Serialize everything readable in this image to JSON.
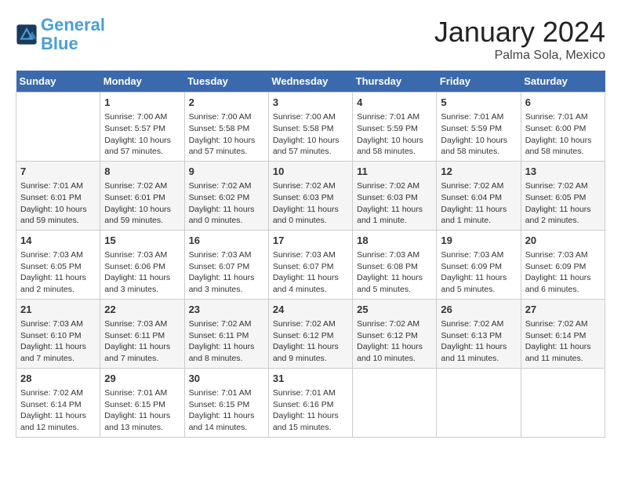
{
  "header": {
    "logo_line1": "General",
    "logo_line2": "Blue",
    "month_title": "January 2024",
    "location": "Palma Sola, Mexico"
  },
  "columns": [
    "Sunday",
    "Monday",
    "Tuesday",
    "Wednesday",
    "Thursday",
    "Friday",
    "Saturday"
  ],
  "weeks": [
    [
      {
        "day": "",
        "content": ""
      },
      {
        "day": "1",
        "content": "Sunrise: 7:00 AM\nSunset: 5:57 PM\nDaylight: 10 hours\nand 57 minutes."
      },
      {
        "day": "2",
        "content": "Sunrise: 7:00 AM\nSunset: 5:58 PM\nDaylight: 10 hours\nand 57 minutes."
      },
      {
        "day": "3",
        "content": "Sunrise: 7:00 AM\nSunset: 5:58 PM\nDaylight: 10 hours\nand 57 minutes."
      },
      {
        "day": "4",
        "content": "Sunrise: 7:01 AM\nSunset: 5:59 PM\nDaylight: 10 hours\nand 58 minutes."
      },
      {
        "day": "5",
        "content": "Sunrise: 7:01 AM\nSunset: 5:59 PM\nDaylight: 10 hours\nand 58 minutes."
      },
      {
        "day": "6",
        "content": "Sunrise: 7:01 AM\nSunset: 6:00 PM\nDaylight: 10 hours\nand 58 minutes."
      }
    ],
    [
      {
        "day": "7",
        "content": "Sunrise: 7:01 AM\nSunset: 6:01 PM\nDaylight: 10 hours\nand 59 minutes."
      },
      {
        "day": "8",
        "content": "Sunrise: 7:02 AM\nSunset: 6:01 PM\nDaylight: 10 hours\nand 59 minutes."
      },
      {
        "day": "9",
        "content": "Sunrise: 7:02 AM\nSunset: 6:02 PM\nDaylight: 11 hours\nand 0 minutes."
      },
      {
        "day": "10",
        "content": "Sunrise: 7:02 AM\nSunset: 6:03 PM\nDaylight: 11 hours\nand 0 minutes."
      },
      {
        "day": "11",
        "content": "Sunrise: 7:02 AM\nSunset: 6:03 PM\nDaylight: 11 hours\nand 1 minute."
      },
      {
        "day": "12",
        "content": "Sunrise: 7:02 AM\nSunset: 6:04 PM\nDaylight: 11 hours\nand 1 minute."
      },
      {
        "day": "13",
        "content": "Sunrise: 7:02 AM\nSunset: 6:05 PM\nDaylight: 11 hours\nand 2 minutes."
      }
    ],
    [
      {
        "day": "14",
        "content": "Sunrise: 7:03 AM\nSunset: 6:05 PM\nDaylight: 11 hours\nand 2 minutes."
      },
      {
        "day": "15",
        "content": "Sunrise: 7:03 AM\nSunset: 6:06 PM\nDaylight: 11 hours\nand 3 minutes."
      },
      {
        "day": "16",
        "content": "Sunrise: 7:03 AM\nSunset: 6:07 PM\nDaylight: 11 hours\nand 3 minutes."
      },
      {
        "day": "17",
        "content": "Sunrise: 7:03 AM\nSunset: 6:07 PM\nDaylight: 11 hours\nand 4 minutes."
      },
      {
        "day": "18",
        "content": "Sunrise: 7:03 AM\nSunset: 6:08 PM\nDaylight: 11 hours\nand 5 minutes."
      },
      {
        "day": "19",
        "content": "Sunrise: 7:03 AM\nSunset: 6:09 PM\nDaylight: 11 hours\nand 5 minutes."
      },
      {
        "day": "20",
        "content": "Sunrise: 7:03 AM\nSunset: 6:09 PM\nDaylight: 11 hours\nand 6 minutes."
      }
    ],
    [
      {
        "day": "21",
        "content": "Sunrise: 7:03 AM\nSunset: 6:10 PM\nDaylight: 11 hours\nand 7 minutes."
      },
      {
        "day": "22",
        "content": "Sunrise: 7:03 AM\nSunset: 6:11 PM\nDaylight: 11 hours\nand 7 minutes."
      },
      {
        "day": "23",
        "content": "Sunrise: 7:02 AM\nSunset: 6:11 PM\nDaylight: 11 hours\nand 8 minutes."
      },
      {
        "day": "24",
        "content": "Sunrise: 7:02 AM\nSunset: 6:12 PM\nDaylight: 11 hours\nand 9 minutes."
      },
      {
        "day": "25",
        "content": "Sunrise: 7:02 AM\nSunset: 6:12 PM\nDaylight: 11 hours\nand 10 minutes."
      },
      {
        "day": "26",
        "content": "Sunrise: 7:02 AM\nSunset: 6:13 PM\nDaylight: 11 hours\nand 11 minutes."
      },
      {
        "day": "27",
        "content": "Sunrise: 7:02 AM\nSunset: 6:14 PM\nDaylight: 11 hours\nand 11 minutes."
      }
    ],
    [
      {
        "day": "28",
        "content": "Sunrise: 7:02 AM\nSunset: 6:14 PM\nDaylight: 11 hours\nand 12 minutes."
      },
      {
        "day": "29",
        "content": "Sunrise: 7:01 AM\nSunset: 6:15 PM\nDaylight: 11 hours\nand 13 minutes."
      },
      {
        "day": "30",
        "content": "Sunrise: 7:01 AM\nSunset: 6:15 PM\nDaylight: 11 hours\nand 14 minutes."
      },
      {
        "day": "31",
        "content": "Sunrise: 7:01 AM\nSunset: 6:16 PM\nDaylight: 11 hours\nand 15 minutes."
      },
      {
        "day": "",
        "content": ""
      },
      {
        "day": "",
        "content": ""
      },
      {
        "day": "",
        "content": ""
      }
    ]
  ]
}
